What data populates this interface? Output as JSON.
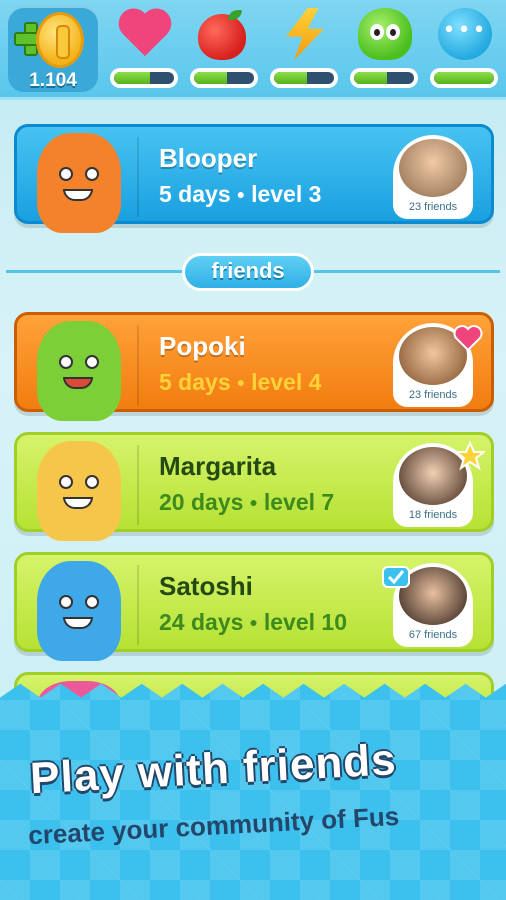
{
  "topbar": {
    "coins": "1.104",
    "stats": [
      {
        "icon": "heart-icon",
        "level": 0.6
      },
      {
        "icon": "apple-icon",
        "level": 0.55
      },
      {
        "icon": "lightning-icon",
        "level": 0.55
      },
      {
        "icon": "blob-face-icon",
        "level": 0.55
      },
      {
        "icon": "chat-bubble-icon",
        "level": 1.0
      }
    ]
  },
  "me": {
    "name": "Blooper",
    "days": "5 days",
    "level": "level 3",
    "friends": "23 friends"
  },
  "section_label": "friends",
  "friends": [
    {
      "name": "Popoki",
      "days": "5 days",
      "level": "level 4",
      "friends": "23 friends",
      "badge": "heart-badge"
    },
    {
      "name": "Margarita",
      "days": "20 days",
      "level": "level 7",
      "friends": "18 friends",
      "badge": "star-badge"
    },
    {
      "name": "Satoshi",
      "days": "24 days",
      "level": "level 10",
      "friends": "67 friends",
      "badge": "check-badge"
    }
  ],
  "banner": {
    "headline": "Play with friends",
    "tagline": "create your community of Fus"
  },
  "colors": {
    "blue_card": "#1aa0e0",
    "orange_card": "#f27d10",
    "green_card": "#b6e234",
    "banner": "#3cc1ee"
  }
}
